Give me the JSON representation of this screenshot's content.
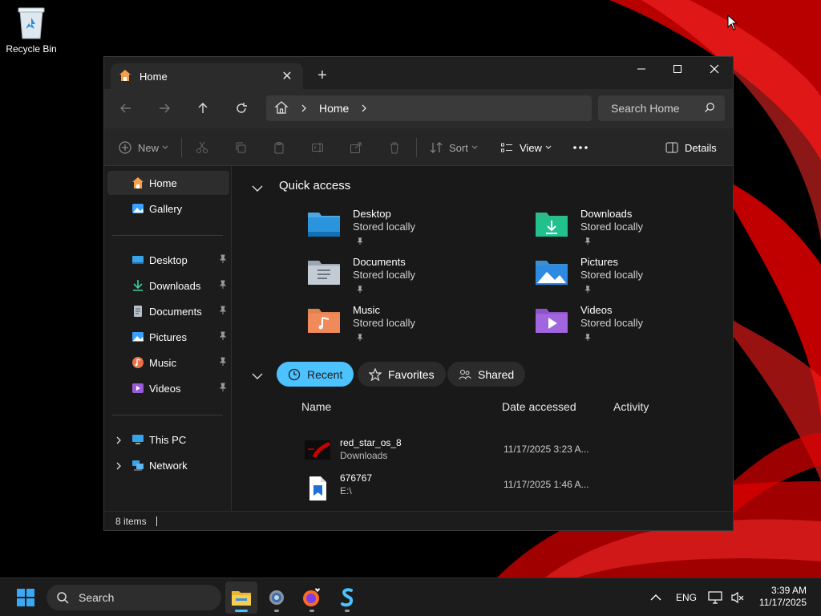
{
  "desktop": {
    "recycle_bin_label": "Recycle Bin"
  },
  "window": {
    "tab_title": "Home",
    "address_crumb": "Home",
    "search_placeholder": "Search Home",
    "toolbar": {
      "new_label": "New",
      "sort_label": "Sort",
      "view_label": "View",
      "details_label": "Details"
    },
    "sidebar": {
      "top_items": [
        {
          "label": "Home",
          "selected": true
        },
        {
          "label": "Gallery",
          "selected": false
        }
      ],
      "pinned_items": [
        {
          "label": "Desktop"
        },
        {
          "label": "Downloads"
        },
        {
          "label": "Documents"
        },
        {
          "label": "Pictures"
        },
        {
          "label": "Music"
        },
        {
          "label": "Videos"
        }
      ],
      "tree_items": [
        {
          "label": "This PC"
        },
        {
          "label": "Network"
        }
      ]
    },
    "quick_access": {
      "heading": "Quick access",
      "items": [
        {
          "name": "Desktop",
          "status": "Stored locally",
          "icon": "desktop-folder-icon"
        },
        {
          "name": "Downloads",
          "status": "Stored locally",
          "icon": "downloads-folder-icon"
        },
        {
          "name": "Documents",
          "status": "Stored locally",
          "icon": "documents-folder-icon"
        },
        {
          "name": "Pictures",
          "status": "Stored locally",
          "icon": "pictures-folder-icon"
        },
        {
          "name": "Music",
          "status": "Stored locally",
          "icon": "music-folder-icon"
        },
        {
          "name": "Videos",
          "status": "Stored locally",
          "icon": "videos-folder-icon"
        }
      ]
    },
    "recent": {
      "pills": {
        "recent": "Recent",
        "favorites": "Favorites",
        "shared": "Shared"
      },
      "columns": {
        "name": "Name",
        "date": "Date accessed",
        "activity": "Activity"
      },
      "files": [
        {
          "name": "red_star_os_8",
          "location": "Downloads",
          "date": "11/17/2025 3:23 A..."
        },
        {
          "name": "676767",
          "location": "E:\\",
          "date": "11/17/2025 1:46 A..."
        }
      ]
    },
    "status": {
      "item_count": "8 items"
    }
  },
  "taskbar": {
    "search_label": "Search",
    "language": "ENG",
    "time": "3:39 AM",
    "date": "11/17/2025"
  },
  "colors": {
    "accent": "#4cc2ff",
    "window_bg": "#191919",
    "taskbar_bg": "#1c1c1c"
  }
}
